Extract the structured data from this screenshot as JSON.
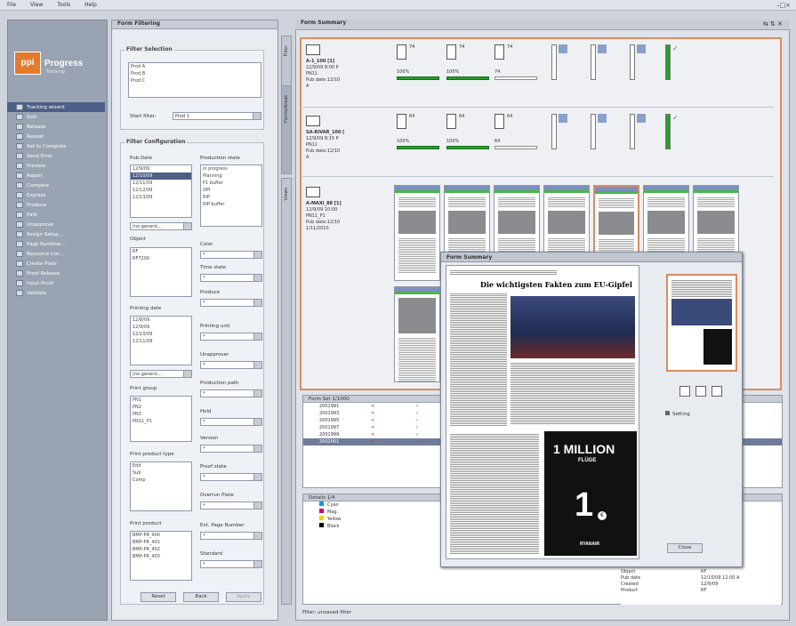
{
  "menu": [
    "File",
    "View",
    "Tools",
    "Help"
  ],
  "window_controls": "–□×",
  "brand": {
    "name": "Progress",
    "sub": "Tracking",
    "logo": "ppi"
  },
  "nav": [
    {
      "label": "Tracking wizard",
      "active": true
    },
    {
      "label": "Sort"
    },
    {
      "label": "Release"
    },
    {
      "label": "Repeat"
    },
    {
      "label": "Set to Complete"
    },
    {
      "label": "Send Error"
    },
    {
      "label": "Preview"
    },
    {
      "label": "Report"
    },
    {
      "label": "Compare"
    },
    {
      "label": "Express"
    },
    {
      "label": "Produce"
    },
    {
      "label": "Path"
    },
    {
      "label": "Unapprove"
    },
    {
      "label": "Assign Setup..."
    },
    {
      "label": "Page Runtime..."
    },
    {
      "label": "Resource List..."
    },
    {
      "label": "Create Plate"
    },
    {
      "label": "Proof Release"
    },
    {
      "label": "Input Proof"
    },
    {
      "label": "Validate"
    }
  ],
  "filter_panel": {
    "title": "Form Filtering",
    "filter_selection": "Filter Selection",
    "products": [
      "Prod A",
      "Prod B",
      "Prod C"
    ],
    "start_filter_label": "Start filter:",
    "start_filter_value": "Prod 1",
    "filter_config": "Filter Configuration",
    "pub_date_label": "Pub Date",
    "pub_dates": [
      "12/9/09",
      "12/10/09",
      "12/11/09",
      "12/12/09",
      "12/13/09"
    ],
    "production_state_label": "Production state",
    "production_states": [
      "in progress",
      "Planning",
      "P1 buffer",
      "OPI",
      "RIP",
      "RIP buffer"
    ],
    "no_generic": "(no generic...",
    "object_label": "Object",
    "objects": [
      "RF",
      "RF7200"
    ],
    "color_label": "Color",
    "time_state_label": "Time state",
    "printing_date_label": "Printing date",
    "printing_dates": [
      "12/8/09",
      "12/9/09",
      "12/10/09",
      "12/11/09"
    ],
    "produce_label": "Produce",
    "printing_unit_label": "Printing unit",
    "unapprover_label": "Unapprover",
    "print_group_label": "Print group",
    "print_groups": [
      "PN1",
      "PN2",
      "PN3",
      "PN11_P1"
    ],
    "production_path_label": "Production path",
    "hold_label": "Hold",
    "version_label": "Version",
    "print_product_type_label": "Print product type",
    "print_product_types": [
      "Edit",
      "Sub",
      "Comp"
    ],
    "proof_state_label": "Proof state",
    "overrun_plate_label": "Overrun Plate",
    "print_product_label": "Print product",
    "print_products": [
      "BMP-PR_400",
      "BMP-PR_401",
      "BMP-PR_402",
      "BMP-PR_403"
    ],
    "ext_page_number_label": "Ext. Page Number",
    "standard_label": "Standard",
    "combo_value": "*",
    "buttons": {
      "reset": "Reset",
      "back": "Back",
      "apply": "Apply"
    }
  },
  "vertical_tabs": [
    "Filter",
    "Forms/Areas",
    "Views"
  ],
  "main": {
    "title": "Form Summary",
    "toolbar_icons": "⇆ ⇅ ✕",
    "rows": [
      {
        "name": "A-1_100 [1]",
        "line2": "12/9/09 8:00 P",
        "line3": "PN11",
        "line4": "Pub date:12/10",
        "line5": "A",
        "counts": [
          "74",
          "74",
          "74"
        ],
        "pcts": [
          "100%",
          "100%",
          "74"
        ]
      },
      {
        "name": "SA-RIVAR_100 [",
        "line2": "12/9/09 8:15 P",
        "line3": "PN11",
        "line4": "Pub date:12/10",
        "line5": "A",
        "counts": [
          "64",
          "64",
          "64"
        ],
        "pcts": [
          "100%",
          "100%",
          "64"
        ]
      },
      {
        "name": "A-MAXI_88 [1]",
        "line2": "12/9/09 10:00",
        "line3": "PN11_P1",
        "line4": "Pub date:12/10",
        "line5": "1/11/2010"
      }
    ]
  },
  "form_list": {
    "title": "Form Set 1/1000",
    "rows": [
      "2001991",
      "2001993",
      "2001995",
      "2001997",
      "2001999",
      "2002001"
    ]
  },
  "details": {
    "title": "Details 1/4",
    "rows": [
      "Cyan",
      "Mag.",
      "Yellow",
      "Black"
    ],
    "props": [
      [
        "Object",
        "RF"
      ],
      [
        "Pub date",
        "12/10/09 12:00 A"
      ],
      [
        "Created",
        "12/9/09"
      ],
      [
        "Product",
        "RF"
      ]
    ]
  },
  "popup": {
    "title": "Form Summary",
    "headline": "Die wichtigsten Fakten zum EU-Gipfel",
    "ad_line1": "1 MILLION",
    "ad_line2": "FLÜGE",
    "ad_price": "1",
    "ad_euro": "€",
    "ad_brand": "RYANAIR",
    "legend_label": "Setting",
    "close": "Close"
  },
  "status": "Filter: unsaved filter",
  "colors": {
    "accent": "#d98c5f",
    "sidebar": "#9aa3b2",
    "nav_active": "#4c5f86",
    "green": "#2a9d2a"
  }
}
